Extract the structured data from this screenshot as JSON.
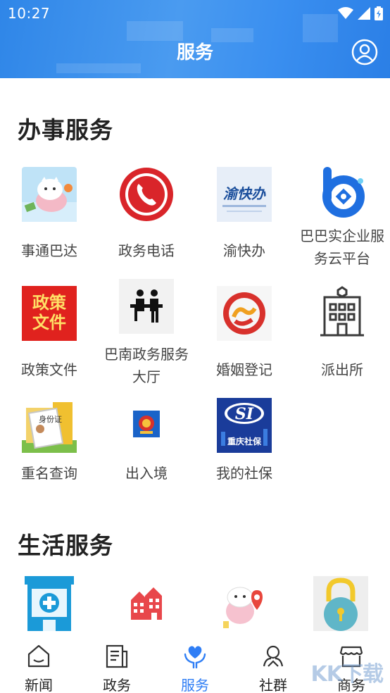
{
  "status_bar": {
    "time": "10:27"
  },
  "header": {
    "title": "服务"
  },
  "sections": {
    "office": {
      "title": "办事服务",
      "items": [
        {
          "label": "事通巴达",
          "icon": "cartoon-tiger-icon"
        },
        {
          "label": "政务电话",
          "icon": "phone-icon"
        },
        {
          "label": "渝快办",
          "icon": "yukuaiban-logo-icon",
          "logo_text": "渝快办"
        },
        {
          "label_line1": "巴巴实企业服",
          "label_line2": "务云平台",
          "icon": "blue-b-logo-icon"
        },
        {
          "label": "政策文件",
          "icon": "policy-doc-icon",
          "logo_line1": "政策",
          "logo_line2": "文件"
        },
        {
          "label_line1": "巴南政务服务",
          "label_line2": "大厅",
          "icon": "service-hall-icon"
        },
        {
          "label": "婚姻登记",
          "icon": "marriage-logo-icon"
        },
        {
          "label": "派出所",
          "icon": "police-station-icon"
        },
        {
          "label": "重名查询",
          "icon": "id-card-icon",
          "logo_text": "身份证"
        },
        {
          "label": "出入境",
          "icon": "police-badge-icon"
        },
        {
          "label": "我的社保",
          "icon": "social-security-icon",
          "logo_text": "重庆社保"
        }
      ]
    },
    "life": {
      "title": "生活服务",
      "items": [
        {
          "icon": "hospital-icon"
        },
        {
          "icon": "buildings-icon"
        },
        {
          "icon": "cartoon-map-icon"
        },
        {
          "icon": "lock-icon"
        }
      ]
    }
  },
  "tabbar": {
    "items": [
      {
        "label": "新闻",
        "icon": "news-icon"
      },
      {
        "label": "政务",
        "icon": "document-icon"
      },
      {
        "label": "服务",
        "icon": "heart-hands-icon",
        "active": true
      },
      {
        "label": "社群",
        "icon": "community-icon"
      },
      {
        "label": "商务",
        "icon": "shop-icon"
      }
    ]
  },
  "watermark": "KK下载",
  "colors": {
    "header": "#3a8ff0",
    "accent": "#2f7ef5",
    "text": "#444444"
  }
}
